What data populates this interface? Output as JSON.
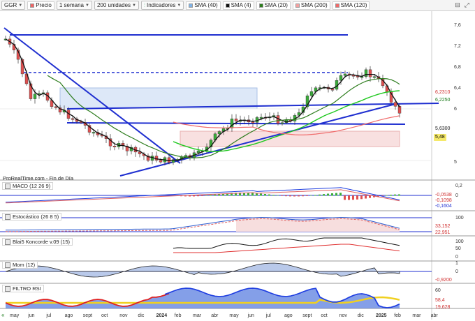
{
  "toolbar": {
    "symbol": "GGR",
    "period": "1 semana",
    "units": "200 unidades",
    "indicators": "Indicadores",
    "legend": [
      {
        "label": "Precio",
        "color": "#ee6666"
      },
      {
        "label": "SMA (40)",
        "color": "#7fb2e6"
      },
      {
        "label": "SMA (4)",
        "color": "#111111"
      },
      {
        "label": "SMA (20)",
        "color": "#2e7d1e"
      },
      {
        "label": "SMA (200)",
        "color": "#f2a0a0"
      },
      {
        "label": "SMA (120)",
        "color": "#f06a6a"
      }
    ]
  },
  "main": {
    "price_ticks": [
      "7,6",
      "7,2",
      "6,8",
      "6,4",
      "6",
      "5",
      "5,48"
    ],
    "badges": [
      {
        "text": "6,2310",
        "bg": "#ffffff",
        "fg": "#d03030"
      },
      {
        "text": "6,2250",
        "bg": "#ffffff",
        "fg": "#1a7a1a"
      },
      {
        "text": "5,6300",
        "bg": "#ffffff",
        "fg": "#222222"
      },
      {
        "text": "5,48",
        "bg": "#f5e96a",
        "fg": "#000000"
      }
    ],
    "footer": "ProRealTime.com - Fin de Día"
  },
  "panels": {
    "macd": {
      "label": "MACD (12 26 9)",
      "ticks": [
        "0,2",
        "0"
      ],
      "badges": [
        "-0,0538",
        "-0,1098",
        "-0,1604"
      ]
    },
    "stoch": {
      "label": "Estocástico (26 8 5)",
      "ticks": [
        "100"
      ],
      "badges": [
        "33,152",
        "22,951"
      ]
    },
    "blai": {
      "label": "Blai5 Koncorde v.09 (15)",
      "ticks": [
        "100",
        "50",
        "0"
      ]
    },
    "mom": {
      "label": "Mom (12)",
      "ticks": [
        "1",
        "0",
        "-0,9200"
      ]
    },
    "filtro": {
      "label": "FILTRO RSI",
      "ticks": [
        "60",
        "58,4",
        "19,628"
      ]
    }
  },
  "xaxis": {
    "labels": [
      "may",
      "jun",
      "jul",
      "ago",
      "sept",
      "oct",
      "nov",
      "dic",
      "2024",
      "feb",
      "mar",
      "abr",
      "may",
      "jun",
      "jul",
      "ago",
      "sept",
      "oct",
      "nov",
      "dic",
      "2025",
      "feb",
      "mar",
      "abr"
    ]
  },
  "colors": {
    "blue_line": "#1f2fd0",
    "up": "#3aaa3a",
    "down": "#e05050"
  }
}
